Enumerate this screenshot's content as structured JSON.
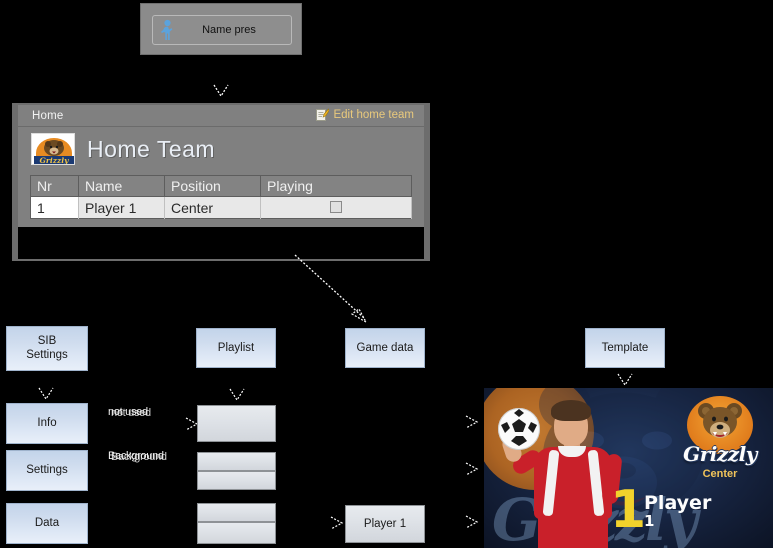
{
  "toolbar": {
    "button_label": "Name pres",
    "person_icon": "person-icon"
  },
  "window": {
    "title": "Home",
    "edit_action": "Edit home team",
    "edit_icon": "note-pencil-icon",
    "team_name": "Home Team",
    "logo_text": "Grizzly",
    "table": {
      "columns": [
        "Nr",
        "Name",
        "Position",
        "Playing"
      ],
      "rows": [
        {
          "nr": "1",
          "name": "Player 1",
          "position": "Center",
          "playing": false
        }
      ]
    }
  },
  "flow": {
    "sib_settings": "SIB\nSettings",
    "sib_settings_line1": "SIB",
    "sib_settings_line2": "Settings",
    "info": "Info",
    "settings": "Settings",
    "data": "Data",
    "playlist": "Playlist",
    "game_data": "Game data",
    "template": "Template",
    "player_box": "Player 1",
    "label_not_used": "not used",
    "label_background": "Background"
  },
  "preview": {
    "badge_word": "Grizzly",
    "position": "Center",
    "number": "1",
    "player_line1": "Player",
    "player_line2": "1"
  },
  "colors": {
    "box_blue": "#cfdcee",
    "box_gray": "#dfe3e8",
    "window_gray": "#808080",
    "edit_link": "#e9c97c",
    "jersey_red": "#c9202a",
    "badge_orange": "#e07c1c",
    "number_yellow": "#f2d22c",
    "background": "#000000"
  }
}
